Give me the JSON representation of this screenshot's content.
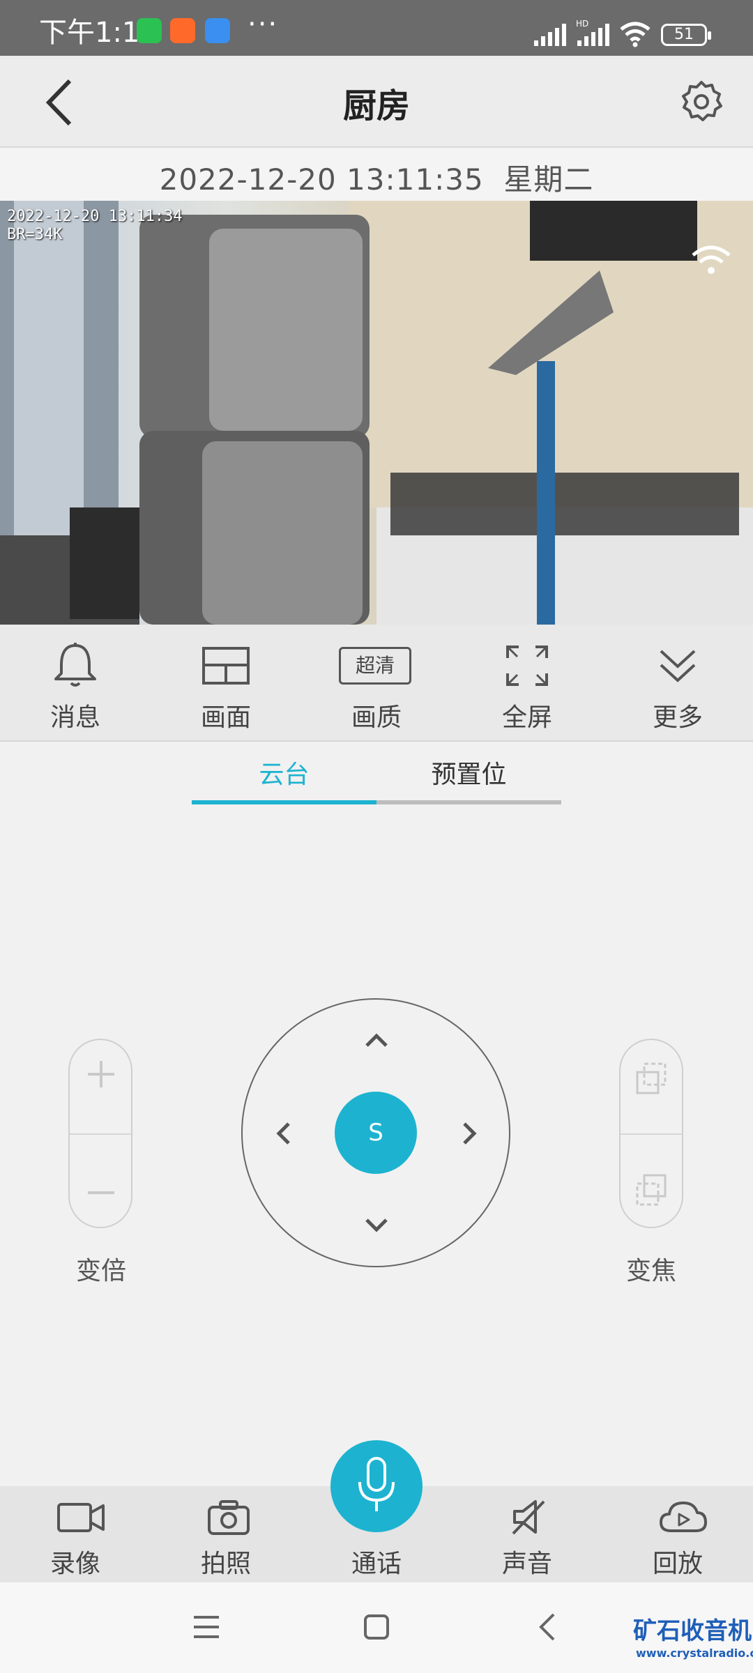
{
  "status_bar": {
    "time": "下午1:11",
    "more": "···",
    "battery": "51"
  },
  "header": {
    "title": "厨房"
  },
  "date_line": "2022-12-20 13:11:35  星期二",
  "video": {
    "timestamp": "2022-12-20 13:11:34",
    "bitrate": "BR=34K"
  },
  "toolbar": [
    {
      "label": "消息",
      "icon": "bell-icon"
    },
    {
      "label": "画面",
      "icon": "grid-icon"
    },
    {
      "label": "画质",
      "icon": "quality-badge",
      "badge": "超清"
    },
    {
      "label": "全屏",
      "icon": "fullscreen-icon"
    },
    {
      "label": "更多",
      "icon": "double-chevron-down-icon"
    }
  ],
  "tabs": [
    {
      "label": "云台",
      "active": true
    },
    {
      "label": "预置位",
      "active": false
    }
  ],
  "ptz": {
    "center_label": "S",
    "zoom_label": "变倍",
    "focus_label": "变焦"
  },
  "bottom_bar": [
    {
      "label": "录像",
      "icon": "video-camera-icon"
    },
    {
      "label": "拍照",
      "icon": "camera-icon"
    },
    {
      "label": "通话",
      "icon": "microphone-icon"
    },
    {
      "label": "声音",
      "icon": "speaker-muted-icon"
    },
    {
      "label": "回放",
      "icon": "cloud-play-icon"
    }
  ],
  "watermark": {
    "title": "矿石收音机",
    "url": "www.crystalradio.cn"
  },
  "colors": {
    "accent": "#1db3d0",
    "inactive_tab": "#bdbdbd"
  }
}
